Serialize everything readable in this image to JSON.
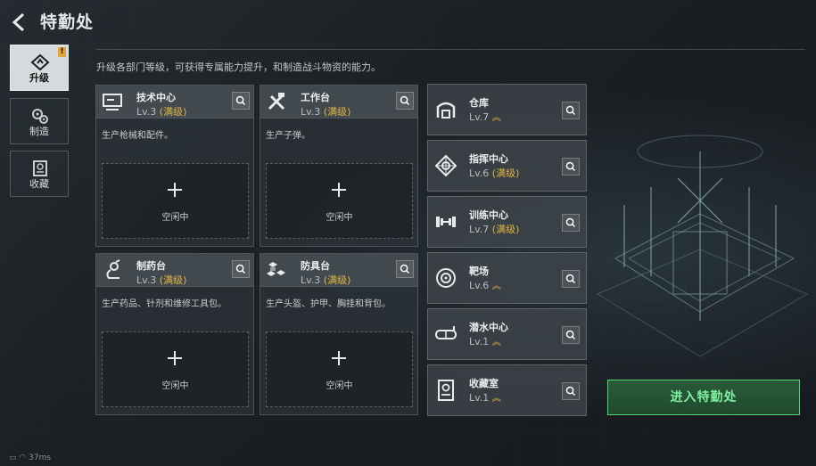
{
  "header": {
    "title": "特勤处",
    "subtitle": "升级各部门等级，可获得专属能力提升，和制造战斗物资的能力。"
  },
  "nav": [
    {
      "label": "升级",
      "badge": "!"
    },
    {
      "label": "制造"
    },
    {
      "label": "收藏"
    }
  ],
  "cards": [
    {
      "name": "技术中心",
      "level": "Lv.3",
      "maxed": "(满级)",
      "desc": "生产枪械和配件。",
      "slot": "空闲中"
    },
    {
      "name": "工作台",
      "level": "Lv.3",
      "maxed": "(满级)",
      "desc": "生产子弹。",
      "slot": "空闲中"
    },
    {
      "name": "制药台",
      "level": "Lv.3",
      "maxed": "(满级)",
      "desc": "生产药品、针剂和维修工具包。",
      "slot": "空闲中"
    },
    {
      "name": "防具台",
      "level": "Lv.3",
      "maxed": "(满级)",
      "desc": "生产头盔、护甲、胸挂和背包。",
      "slot": "空闲中"
    }
  ],
  "departments": [
    {
      "name": "仓库",
      "level": "Lv.7",
      "maxed": "",
      "up": "︽"
    },
    {
      "name": "指挥中心",
      "level": "Lv.6",
      "maxed": "(满级)",
      "up": ""
    },
    {
      "name": "训练中心",
      "level": "Lv.7",
      "maxed": "(满级)",
      "up": ""
    },
    {
      "name": "靶场",
      "level": "Lv.6",
      "maxed": "",
      "up": "︽"
    },
    {
      "name": "潜水中心",
      "level": "Lv.1",
      "maxed": "",
      "up": "︽"
    },
    {
      "name": "收藏室",
      "level": "Lv.1",
      "maxed": "",
      "up": "︽"
    }
  ],
  "enter_button": "进入特勤处",
  "status": {
    "ping": "37ms"
  },
  "colors": {
    "accent_gold": "#e0b545",
    "enter_green": "#4fd27a"
  }
}
